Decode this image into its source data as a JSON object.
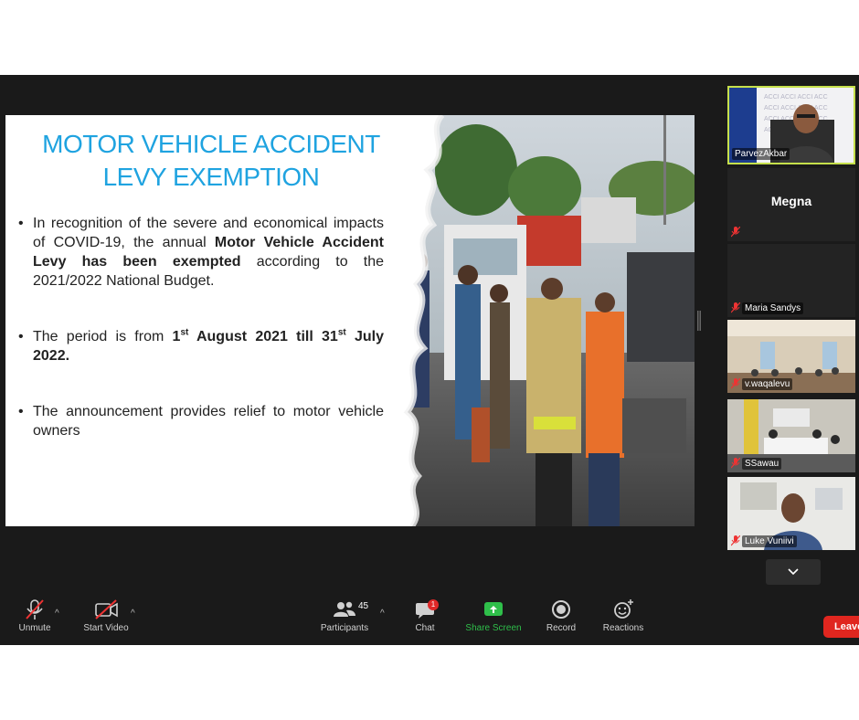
{
  "slide": {
    "title_line1": "MOTOR VEHICLE ACCIDENT",
    "title_line2": "LEVY EXEMPTION",
    "bullet1": {
      "t1": "In recognition of the severe and economical impacts of COVID-19, the annual ",
      "b1": "Motor Vehicle Accident Levy has been exempted",
      "t2": " according to the 2021/2022 National Budget."
    },
    "bullet2": {
      "t1": "The period is from ",
      "b1": "1",
      "s1": "st",
      "b2": " August 2021 till 31",
      "s2": "st",
      "b3": " July 2022."
    },
    "bullet3": "The announcement provides relief to motor vehicle owners"
  },
  "participants": [
    {
      "name": "ParvezAkbar",
      "active": true,
      "video": true
    },
    {
      "name": "Megna",
      "video": false,
      "muted": true
    },
    {
      "name": "Maria Sandys",
      "video": false,
      "muted": true
    },
    {
      "name": "v.waqalevu",
      "video": true,
      "muted": true
    },
    {
      "name": "SSawau",
      "video": true,
      "muted": true
    },
    {
      "name": "Luke Vuniivi",
      "video": true,
      "muted": true
    }
  ],
  "toolbar": {
    "unmute": "Unmute",
    "start_video": "Start Video",
    "participants": "Participants",
    "participants_count": "45",
    "chat": "Chat",
    "chat_badge": "1",
    "share_screen": "Share Screen",
    "record": "Record",
    "reactions": "Reactions",
    "leave": "Leave"
  },
  "colors": {
    "title_blue": "#1fa3e0",
    "share_green": "#2fbf4a",
    "leave_red": "#e0261f",
    "active_speaker": "#c6e04b"
  },
  "icons": [
    "mic-muted-icon",
    "video-off-icon",
    "participants-icon",
    "chat-icon",
    "share-screen-icon",
    "record-icon",
    "reactions-icon",
    "chevron-down-icon"
  ]
}
